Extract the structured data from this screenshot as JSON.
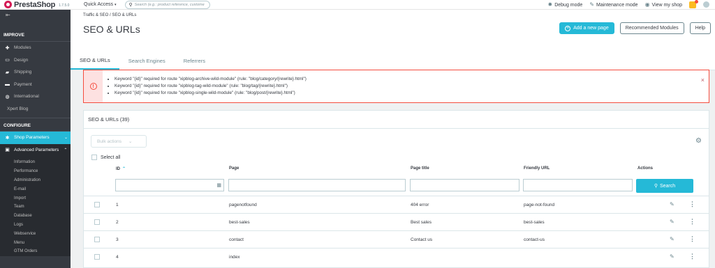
{
  "topbar": {
    "logo": "PrestaShop",
    "version": "1.7.5.0",
    "quick_access": "Quick Access",
    "search_placeholder": "Search (e.g.: product reference, custome",
    "debug_mode": "Debug mode",
    "maintenance_mode": "Maintenance mode",
    "view_shop": "View my shop"
  },
  "sidebar": {
    "improve_title": "IMPROVE",
    "improve_items": [
      {
        "label": "Modules",
        "icon": "puzzle-icon"
      },
      {
        "label": "Design",
        "icon": "desktop-icon"
      },
      {
        "label": "Shipping",
        "icon": "truck-icon"
      },
      {
        "label": "Payment",
        "icon": "card-icon"
      },
      {
        "label": "International",
        "icon": "globe-icon"
      },
      {
        "label": "Xpert Blog",
        "icon": ""
      }
    ],
    "configure_title": "CONFIGURE",
    "configure_items": [
      {
        "label": "Shop Parameters",
        "icon": "settings-icon"
      },
      {
        "label": "Advanced Parameters",
        "icon": "advanced-icon"
      }
    ],
    "sub_items": [
      "Information",
      "Performance",
      "Administration",
      "E-mail",
      "Import",
      "Team",
      "Database",
      "Logs",
      "Webservice",
      "Menu",
      "GTM Orders"
    ]
  },
  "header": {
    "breadcrumb": [
      "Traffic & SEO",
      "SEO & URLs"
    ],
    "title": "SEO & URLs",
    "add_page": "Add a new page",
    "recommended": "Recommended Modules",
    "help": "Help",
    "tabs": [
      "SEO & URLs",
      "Search Engines",
      "Referrers"
    ]
  },
  "alert": {
    "messages": [
      "Keyword \"{id}\" required for route \"xipblog-archive-wild-module\" (rule: \"blog/category/{rewrite}.html\")",
      "Keyword \"{id}\" required for route \"xipblog-tag-wild-module\" (rule: \"blog/tag/{rewrite}.html\")",
      "Keyword \"{id}\" required for route \"xipblog-single-wild-module\" (rule: \"blog/post/{rewrite}.html\")"
    ],
    "close": "×"
  },
  "panel": {
    "title": "SEO & URLs (39)",
    "bulk_actions": "Bulk actions",
    "select_all": "Select all",
    "columns": [
      "ID",
      "Page",
      "Page title",
      "Friendly URL",
      "Actions"
    ],
    "search_button": "Search",
    "rows": [
      {
        "id": "1",
        "page": "pagenotfound",
        "title": "404 error",
        "url": "page-not-found"
      },
      {
        "id": "2",
        "page": "best-sales",
        "title": "Best sales",
        "url": "best-sales"
      },
      {
        "id": "3",
        "page": "contact",
        "title": "Contact us",
        "url": "contact-us"
      },
      {
        "id": "4",
        "page": "index",
        "title": "",
        "url": ""
      }
    ]
  }
}
